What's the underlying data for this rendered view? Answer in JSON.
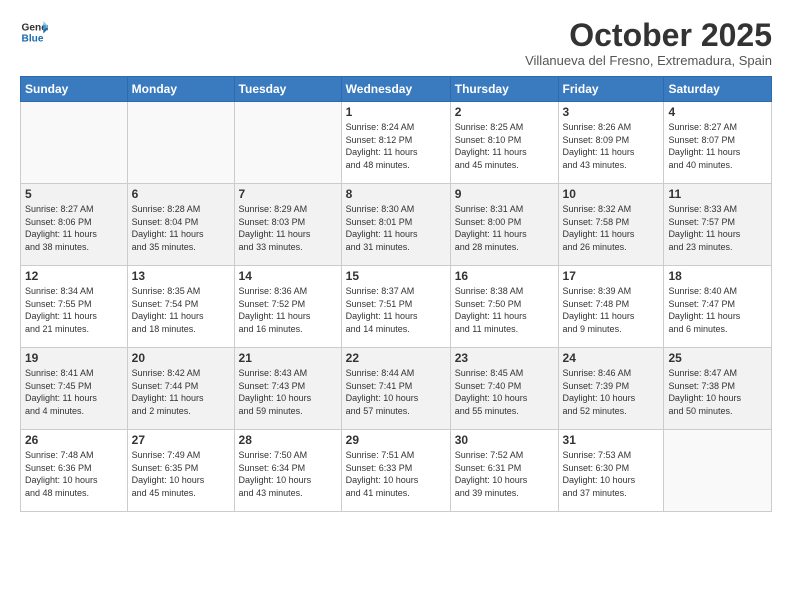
{
  "logo": {
    "line1": "General",
    "line2": "Blue"
  },
  "header": {
    "month": "October 2025",
    "location": "Villanueva del Fresno, Extremadura, Spain"
  },
  "weekdays": [
    "Sunday",
    "Monday",
    "Tuesday",
    "Wednesday",
    "Thursday",
    "Friday",
    "Saturday"
  ],
  "weeks": [
    [
      {
        "day": "",
        "info": ""
      },
      {
        "day": "",
        "info": ""
      },
      {
        "day": "",
        "info": ""
      },
      {
        "day": "1",
        "info": "Sunrise: 8:24 AM\nSunset: 8:12 PM\nDaylight: 11 hours\nand 48 minutes."
      },
      {
        "day": "2",
        "info": "Sunrise: 8:25 AM\nSunset: 8:10 PM\nDaylight: 11 hours\nand 45 minutes."
      },
      {
        "day": "3",
        "info": "Sunrise: 8:26 AM\nSunset: 8:09 PM\nDaylight: 11 hours\nand 43 minutes."
      },
      {
        "day": "4",
        "info": "Sunrise: 8:27 AM\nSunset: 8:07 PM\nDaylight: 11 hours\nand 40 minutes."
      }
    ],
    [
      {
        "day": "5",
        "info": "Sunrise: 8:27 AM\nSunset: 8:06 PM\nDaylight: 11 hours\nand 38 minutes."
      },
      {
        "day": "6",
        "info": "Sunrise: 8:28 AM\nSunset: 8:04 PM\nDaylight: 11 hours\nand 35 minutes."
      },
      {
        "day": "7",
        "info": "Sunrise: 8:29 AM\nSunset: 8:03 PM\nDaylight: 11 hours\nand 33 minutes."
      },
      {
        "day": "8",
        "info": "Sunrise: 8:30 AM\nSunset: 8:01 PM\nDaylight: 11 hours\nand 31 minutes."
      },
      {
        "day": "9",
        "info": "Sunrise: 8:31 AM\nSunset: 8:00 PM\nDaylight: 11 hours\nand 28 minutes."
      },
      {
        "day": "10",
        "info": "Sunrise: 8:32 AM\nSunset: 7:58 PM\nDaylight: 11 hours\nand 26 minutes."
      },
      {
        "day": "11",
        "info": "Sunrise: 8:33 AM\nSunset: 7:57 PM\nDaylight: 11 hours\nand 23 minutes."
      }
    ],
    [
      {
        "day": "12",
        "info": "Sunrise: 8:34 AM\nSunset: 7:55 PM\nDaylight: 11 hours\nand 21 minutes."
      },
      {
        "day": "13",
        "info": "Sunrise: 8:35 AM\nSunset: 7:54 PM\nDaylight: 11 hours\nand 18 minutes."
      },
      {
        "day": "14",
        "info": "Sunrise: 8:36 AM\nSunset: 7:52 PM\nDaylight: 11 hours\nand 16 minutes."
      },
      {
        "day": "15",
        "info": "Sunrise: 8:37 AM\nSunset: 7:51 PM\nDaylight: 11 hours\nand 14 minutes."
      },
      {
        "day": "16",
        "info": "Sunrise: 8:38 AM\nSunset: 7:50 PM\nDaylight: 11 hours\nand 11 minutes."
      },
      {
        "day": "17",
        "info": "Sunrise: 8:39 AM\nSunset: 7:48 PM\nDaylight: 11 hours\nand 9 minutes."
      },
      {
        "day": "18",
        "info": "Sunrise: 8:40 AM\nSunset: 7:47 PM\nDaylight: 11 hours\nand 6 minutes."
      }
    ],
    [
      {
        "day": "19",
        "info": "Sunrise: 8:41 AM\nSunset: 7:45 PM\nDaylight: 11 hours\nand 4 minutes."
      },
      {
        "day": "20",
        "info": "Sunrise: 8:42 AM\nSunset: 7:44 PM\nDaylight: 11 hours\nand 2 minutes."
      },
      {
        "day": "21",
        "info": "Sunrise: 8:43 AM\nSunset: 7:43 PM\nDaylight: 10 hours\nand 59 minutes."
      },
      {
        "day": "22",
        "info": "Sunrise: 8:44 AM\nSunset: 7:41 PM\nDaylight: 10 hours\nand 57 minutes."
      },
      {
        "day": "23",
        "info": "Sunrise: 8:45 AM\nSunset: 7:40 PM\nDaylight: 10 hours\nand 55 minutes."
      },
      {
        "day": "24",
        "info": "Sunrise: 8:46 AM\nSunset: 7:39 PM\nDaylight: 10 hours\nand 52 minutes."
      },
      {
        "day": "25",
        "info": "Sunrise: 8:47 AM\nSunset: 7:38 PM\nDaylight: 10 hours\nand 50 minutes."
      }
    ],
    [
      {
        "day": "26",
        "info": "Sunrise: 7:48 AM\nSunset: 6:36 PM\nDaylight: 10 hours\nand 48 minutes."
      },
      {
        "day": "27",
        "info": "Sunrise: 7:49 AM\nSunset: 6:35 PM\nDaylight: 10 hours\nand 45 minutes."
      },
      {
        "day": "28",
        "info": "Sunrise: 7:50 AM\nSunset: 6:34 PM\nDaylight: 10 hours\nand 43 minutes."
      },
      {
        "day": "29",
        "info": "Sunrise: 7:51 AM\nSunset: 6:33 PM\nDaylight: 10 hours\nand 41 minutes."
      },
      {
        "day": "30",
        "info": "Sunrise: 7:52 AM\nSunset: 6:31 PM\nDaylight: 10 hours\nand 39 minutes."
      },
      {
        "day": "31",
        "info": "Sunrise: 7:53 AM\nSunset: 6:30 PM\nDaylight: 10 hours\nand 37 minutes."
      },
      {
        "day": "",
        "info": ""
      }
    ]
  ],
  "shaded_rows": [
    1,
    3
  ]
}
